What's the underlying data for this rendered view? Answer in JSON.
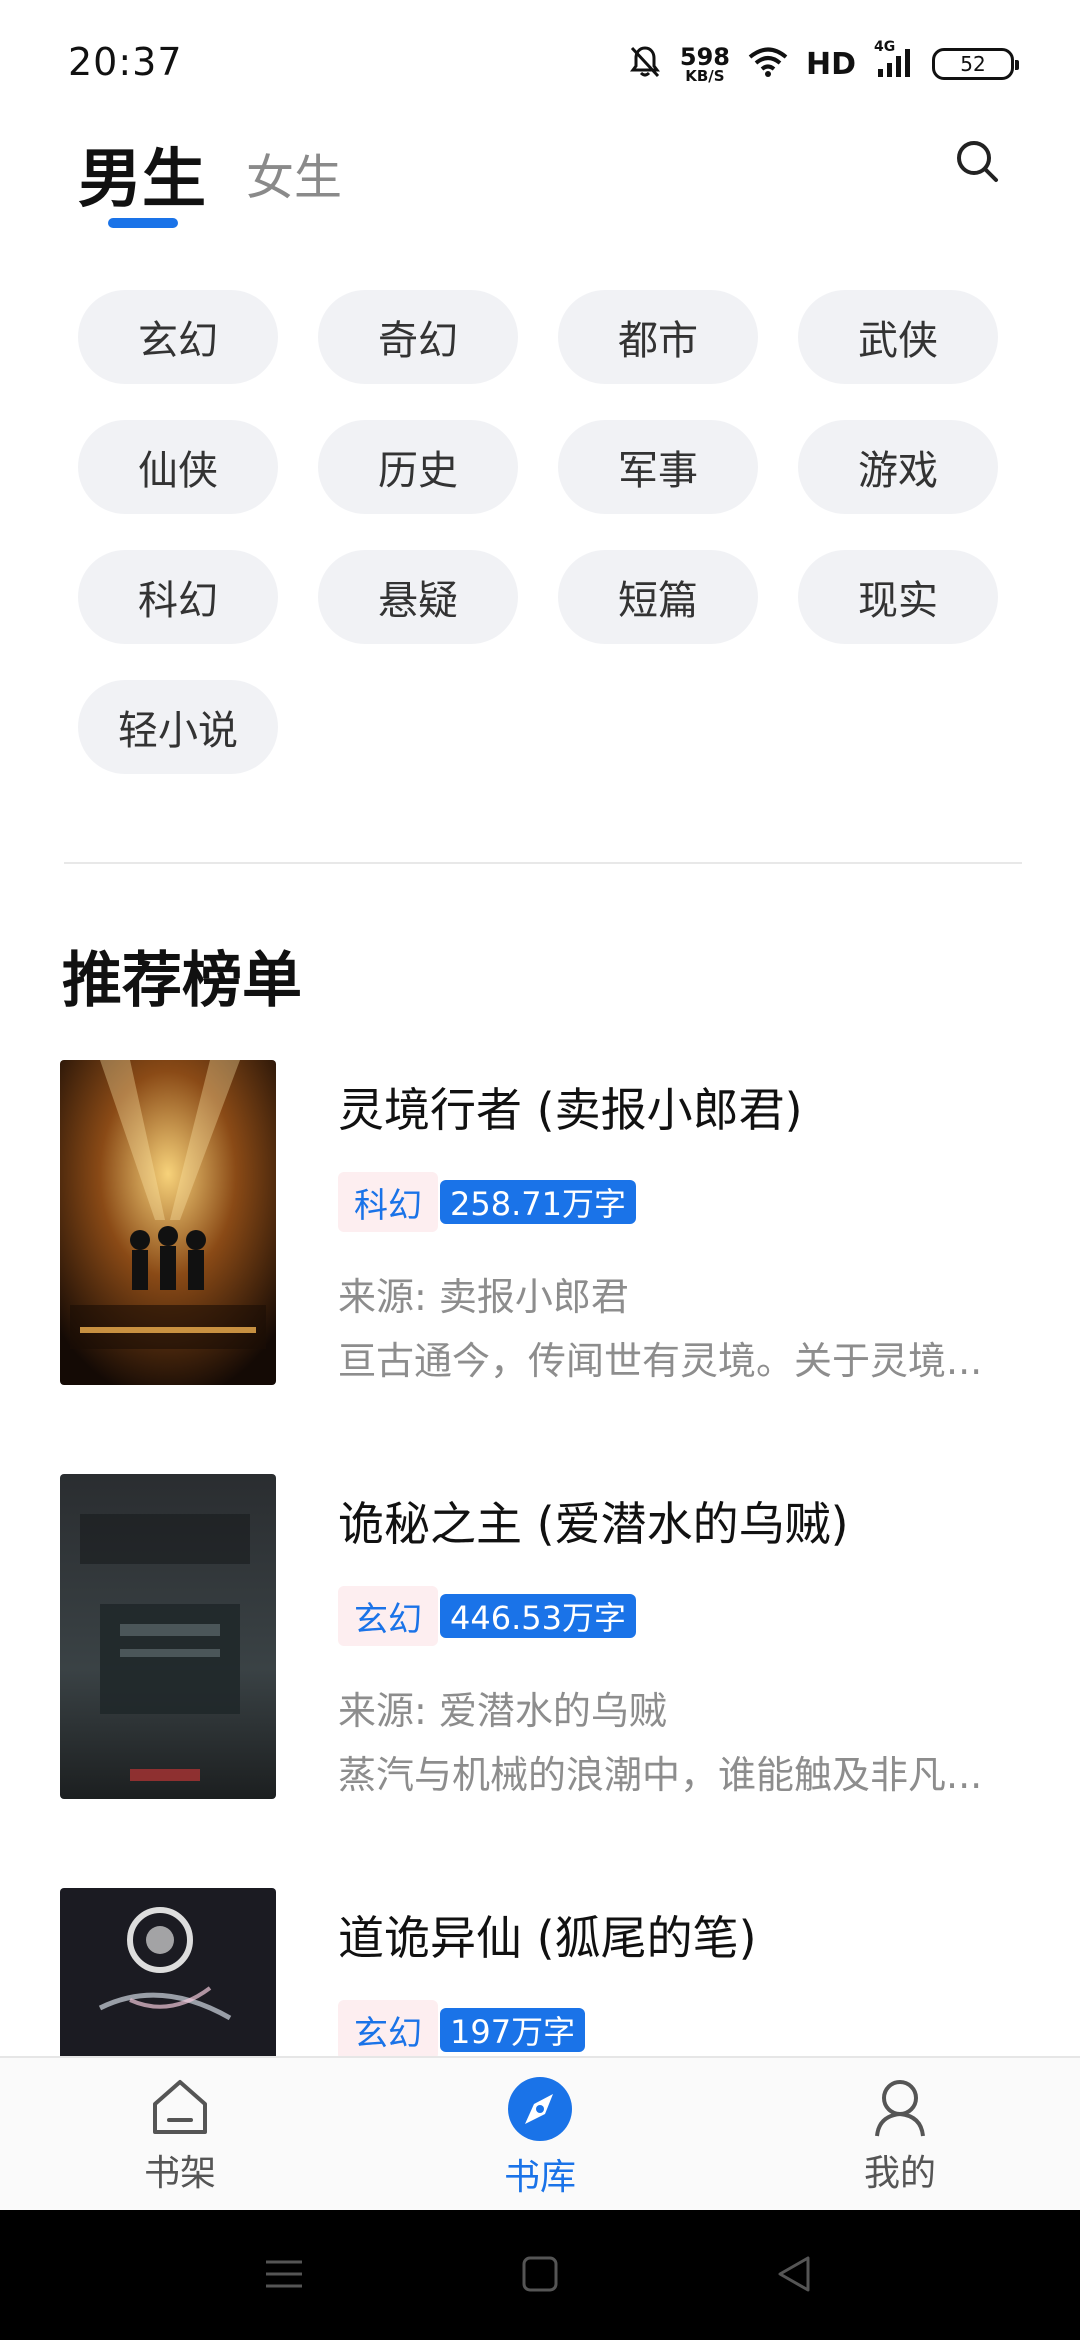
{
  "status_bar": {
    "time": "20:37",
    "net_speed_value": "598",
    "net_speed_unit": "KB/S",
    "network_label": "HD",
    "signal_label": "4G",
    "battery": "52"
  },
  "header": {
    "tabs": [
      {
        "label": "男生",
        "active": true
      },
      {
        "label": "女生",
        "active": false
      }
    ],
    "accent_color": "#1a73e8"
  },
  "categories": [
    "玄幻",
    "奇幻",
    "都市",
    "武侠",
    "仙侠",
    "历史",
    "军事",
    "游戏",
    "科幻",
    "悬疑",
    "短篇",
    "现实",
    "轻小说"
  ],
  "section_title": "推荐榜单",
  "books": [
    {
      "title": "灵境行者 (卖报小郎君)",
      "genre": "科幻",
      "words": "258.71万字",
      "source": "来源: 卖报小郎君",
      "desc": "亘古通今，传闻世有灵境。关于灵境..."
    },
    {
      "title": "诡秘之主 (爱潜水的乌贼)",
      "genre": "玄幻",
      "words": "446.53万字",
      "source": "来源: 爱潜水的乌贼",
      "desc": "蒸汽与机械的浪潮中，谁能触及非凡..."
    },
    {
      "title": "道诡异仙 (狐尾的笔)",
      "genre": "玄幻",
      "words": "197万字",
      "source": "",
      "desc": ""
    }
  ],
  "bottom_nav": [
    {
      "label": "书架",
      "icon": "bookshelf-home-icon",
      "active": false
    },
    {
      "label": "书库",
      "icon": "compass-icon",
      "active": true
    },
    {
      "label": "我的",
      "icon": "user-icon",
      "active": false
    }
  ],
  "system_nav": [
    "menu-icon",
    "home-square-icon",
    "back-triangle-icon"
  ]
}
